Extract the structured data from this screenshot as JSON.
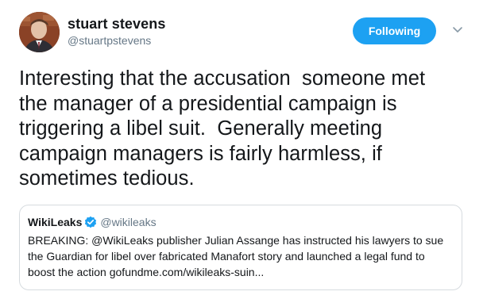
{
  "author": {
    "display_name": "stuart stevens",
    "handle": "@stuartpstevens",
    "avatar_icon": "profile-photo"
  },
  "follow_button": {
    "label": "Following",
    "color": "#1da1f2"
  },
  "menu_icon": "chevron-down-icon",
  "tweet": {
    "text": "Interesting that the accusation  someone met\nthe manager of a presidential campaign is\ntriggering a libel suit.  Generally meeting\ncampaign managers is fairly harmless, if\nsometimes tedious."
  },
  "quoted_tweet": {
    "display_name": "WikiLeaks",
    "verified_icon": "verified-badge-icon",
    "handle": "@wikileaks",
    "text": "BREAKING: @WikiLeaks publisher Julian Assange has instructed his lawyers to sue\nthe Guardian for libel over fabricated Manafort story and launched a legal fund to\nboost the action gofundme.com/wikileaks-suin..."
  },
  "colors": {
    "text_primary": "#14171a",
    "text_secondary": "#657786",
    "border": "#d6dbdf",
    "accent": "#1da1f2"
  }
}
